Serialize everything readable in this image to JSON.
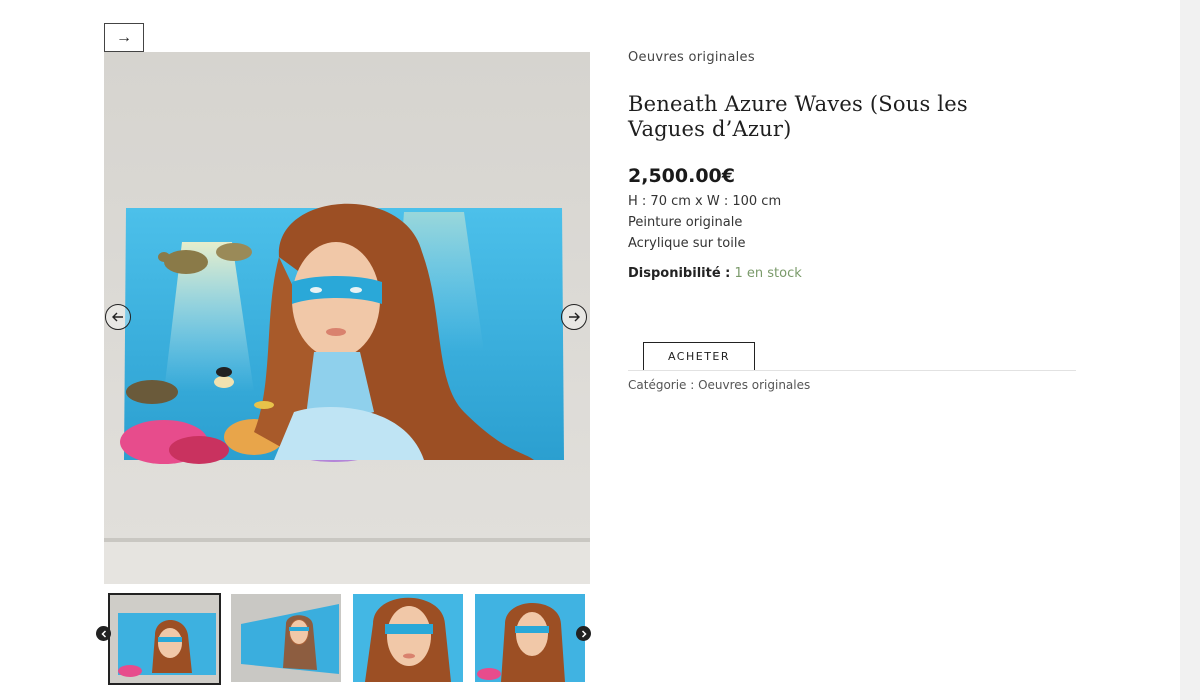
{
  "nav": {
    "arrow_label": "→"
  },
  "gallery": {
    "main_image": "painting-on-wall",
    "thumbnails": [
      "painting-front",
      "painting-angled",
      "painting-closeup",
      "painting-full"
    ],
    "active_index": 0
  },
  "product": {
    "category_link": "Oeuvres originales",
    "title_line1": "Beneath Azure Waves (Sous les",
    "title_line2": "Vagues d’Azur)",
    "price": "2,500.00€",
    "description": [
      "H : 70 cm x W : 100 cm",
      "Peinture originale",
      "Acrylique sur toile"
    ],
    "availability_label": "Disponibilité :",
    "availability_value": "1 en stock",
    "buy_label": "ACHETER",
    "meta_category": "Catégorie : Oeuvres originales"
  },
  "colors": {
    "stock": "#7a9a6a",
    "sea": "#3fb0dd",
    "hair": "#a3582a"
  }
}
